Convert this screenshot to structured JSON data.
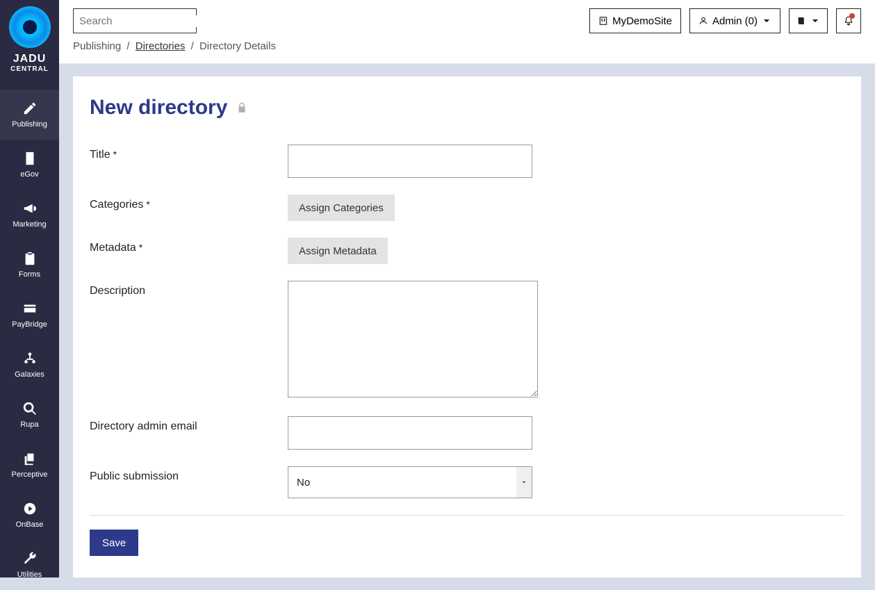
{
  "brand": {
    "name": "JADU",
    "sub": "CENTRAL"
  },
  "sidebar": {
    "items": [
      {
        "label": "Publishing"
      },
      {
        "label": "eGov"
      },
      {
        "label": "Marketing"
      },
      {
        "label": "Forms"
      },
      {
        "label": "PayBridge"
      },
      {
        "label": "Galaxies"
      },
      {
        "label": "Rupa"
      },
      {
        "label": "Perceptive"
      },
      {
        "label": "OnBase"
      },
      {
        "label": "Utilities"
      }
    ]
  },
  "topbar": {
    "search_placeholder": "Search",
    "site_button": "MyDemoSite",
    "user_button": "Admin (0)"
  },
  "breadcrumb": {
    "part1": "Publishing",
    "part2": "Directories",
    "part3": "Directory Details"
  },
  "page": {
    "title": "New directory"
  },
  "form": {
    "title_label": "Title",
    "categories_label": "Categories",
    "categories_button": "Assign Categories",
    "metadata_label": "Metadata",
    "metadata_button": "Assign Metadata",
    "description_label": "Description",
    "admin_email_label": "Directory admin email",
    "public_submission_label": "Public submission",
    "public_submission_value": "No",
    "save_button": "Save"
  }
}
